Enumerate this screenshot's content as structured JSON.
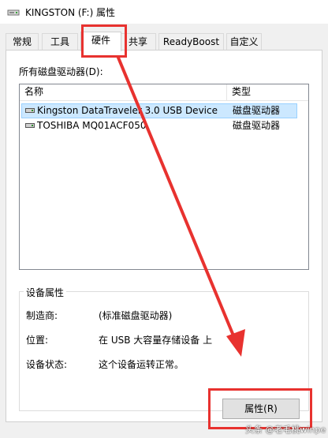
{
  "window": {
    "title": "KINGSTON (F:) 属性",
    "icon": "drive-icon"
  },
  "tabs": [
    {
      "label": "常规",
      "active": false
    },
    {
      "label": "工具",
      "active": false
    },
    {
      "label": "硬件",
      "active": true
    },
    {
      "label": "共享",
      "active": false
    },
    {
      "label": "ReadyBoost",
      "active": false
    },
    {
      "label": "自定义",
      "active": false
    }
  ],
  "hardware": {
    "drives_label": "所有磁盘驱动器(D):",
    "columns": [
      "名称",
      "类型"
    ],
    "rows": [
      {
        "name": "Kingston DataTraveler 3.0 USB Device",
        "type": "磁盘驱动器",
        "selected": true,
        "icon": "disk-drive-icon"
      },
      {
        "name": "TOSHIBA MQ01ACF050",
        "type": "磁盘驱动器",
        "selected": false,
        "icon": "disk-drive-icon"
      }
    ]
  },
  "device_properties": {
    "group_title": "设备属性",
    "fields": [
      {
        "label": "制造商:",
        "value": "(标准磁盘驱动器)"
      },
      {
        "label": "位置:",
        "value": "在 USB 大容量存储设备 上"
      },
      {
        "label": "设备状态:",
        "value": "这个设备运转正常。"
      }
    ],
    "properties_button": "属性(R)"
  },
  "watermark": "头条 @老毛桃winpe",
  "colors": {
    "annotation_red": "#e8322f",
    "selection_bg": "#cce8ff",
    "selection_border": "#99d1ff"
  }
}
